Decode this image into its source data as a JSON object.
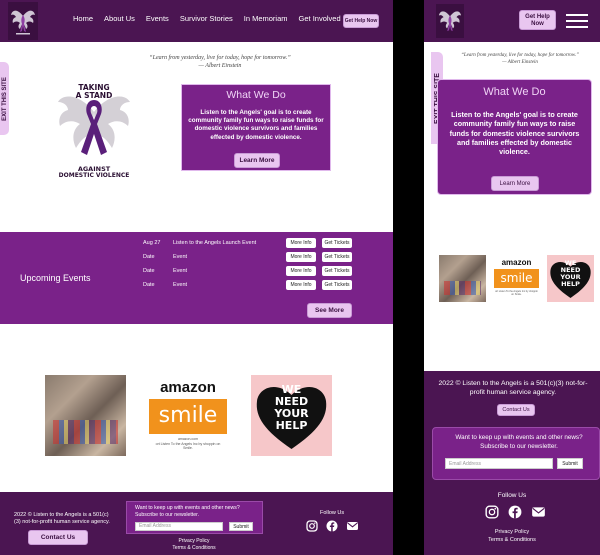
{
  "colors": {
    "primary_dark": "#4b1552",
    "primary": "#7a2289",
    "accent_light": "#e9c6f0"
  },
  "header": {
    "logo_alt": "Listen to the Angels",
    "nav": [
      "Home",
      "About Us",
      "Events",
      "Survivor Stories",
      "In Memoriam",
      "Get Involved"
    ],
    "get_help": "Get Help Now"
  },
  "quote": {
    "text": "“Learn from yesterday, live for today, hope for tomorrow.”",
    "author": "— Albert Einstein"
  },
  "exit_tab": "EXIT THIS SITE",
  "ribbon_logo": {
    "line1": "TAKING",
    "line2": "A STAND",
    "line3": "AGAINST",
    "line4": "DOMESTIC VIOLENCE"
  },
  "what_we_do": {
    "title": "What We Do",
    "body_desktop": "Listen to the Angels' goal is to create community family fun ways to raise funds for domestic violence survivors and families effected by domestic violence.",
    "body_mobile": "Listen to the Angels' goal is to create community family fun ways to raise funds for domestic violence survivors and families  effected by domestic violence.",
    "button": "Learn More"
  },
  "events": {
    "title": "Upcoming Events",
    "rows": [
      {
        "date": "Aug 27",
        "name": "Listen to the Angels Launch Event"
      },
      {
        "date": "Date",
        "name": "Event"
      },
      {
        "date": "Date",
        "name": "Event"
      },
      {
        "date": "Date",
        "name": "Event"
      }
    ],
    "more_info": "More Info",
    "get_tickets": "Get Tickets",
    "see_more": "See More"
  },
  "gallery": {
    "amazon_word": "amazon",
    "smile_word": "smile",
    "amazon_caption": "amazon.com",
    "amazon_note": "ort Listen To the Angels Inc by shoppin on Smile.",
    "help_line1": "WE",
    "help_line2": "NEED",
    "help_line3": "YOUR",
    "help_line4": "HELP"
  },
  "footer": {
    "copyright": "2022 © Listen to the Angels is a 501(c)(3) not-for-profit human service agency.",
    "contact": "Contact Us",
    "newsletter_text": "Want to keep up with events and other news? Subscribe to our newsletter.",
    "email_placeholder": "Email Address",
    "submit": "Submit",
    "follow": "Follow Us",
    "privacy": "Privacy Policy",
    "terms": "Terms & Conditions"
  },
  "icons": [
    "instagram-icon",
    "facebook-icon",
    "email-icon",
    "hamburger-menu-icon"
  ]
}
